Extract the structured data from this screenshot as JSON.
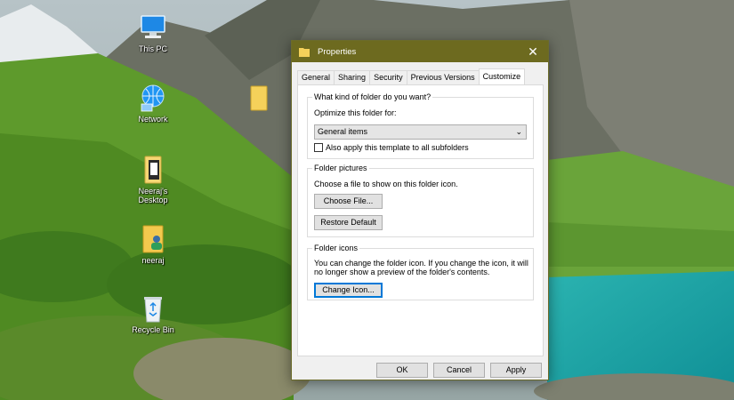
{
  "desktop": {
    "icons": [
      {
        "label": "This PC",
        "icon": "this-pc-icon"
      },
      {
        "label": "Network",
        "icon": "network-icon"
      },
      {
        "label": "Neeraj's Desktop",
        "icon": "folder-icon"
      },
      {
        "label": "neeraj",
        "icon": "user-folder-icon"
      },
      {
        "label": "Recycle Bin",
        "icon": "recycle-bin-icon"
      }
    ]
  },
  "dialog": {
    "title": "Properties",
    "close_glyph": "✕",
    "tabs": [
      {
        "label": "General",
        "active": false
      },
      {
        "label": "Sharing",
        "active": false
      },
      {
        "label": "Security",
        "active": false
      },
      {
        "label": "Previous Versions",
        "active": false
      },
      {
        "label": "Customize",
        "active": true
      }
    ],
    "kind_group": {
      "legend": "What kind of folder do you want?",
      "optimize_label": "Optimize this folder for:",
      "selected_option": "General items",
      "subfolders_checkbox_label": "Also apply this template to all subfolders",
      "subfolders_checked": false
    },
    "pictures_group": {
      "legend": "Folder pictures",
      "description": "Choose a file to show on this folder icon.",
      "choose_file_label": "Choose File...",
      "restore_default_label": "Restore Default"
    },
    "icons_group": {
      "legend": "Folder icons",
      "description_line1": "You can change the folder icon. If you change the icon, it will",
      "description_line2": "no longer show a preview of the folder's contents.",
      "change_icon_label": "Change Icon..."
    },
    "footer": {
      "ok_label": "OK",
      "cancel_label": "Cancel",
      "apply_label": "Apply"
    }
  },
  "colors": {
    "titlebar": "#6d6a1f",
    "focus_border": "#0078d7"
  }
}
